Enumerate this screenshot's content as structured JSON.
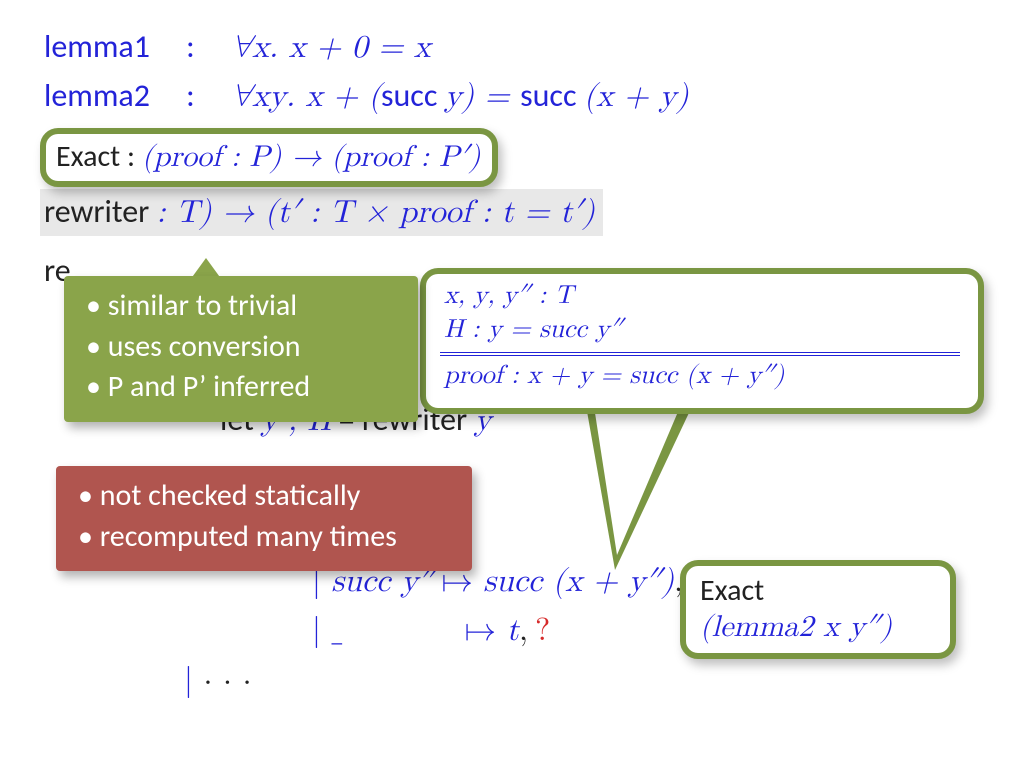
{
  "lemma1_name": "lemma1",
  "lemma2_name": "lemma2",
  "lemma_colon": ":",
  "lemma1_stmt": "∀x. x + 0 = x",
  "lemma2_stmt_pre": "∀xy. x + (",
  "lemma2_succ": "succ ",
  "lemma2_stmt_mid": "y) = ",
  "lemma2_stmt_post": "(x + y)",
  "exact_sig_label": "Exact",
  "exact_sig_colon": " : ",
  "exact_sig_body": "(proof : P) → (proof : P′)",
  "rewriter": "rewriter",
  "rewriter_sig": " : T) → (t′ : T × proof : t = t′)",
  "re_fragment": "re",
  "let_kw": "let ",
  "let_lhs": "y′,  H",
  "let_eq": "  =  ",
  "let_rhs1": "rewriter ",
  "let_rhs2": "y",
  "case_succ_l": "succ y″",
  "case_arrow": " ↦ ",
  "case_succ_r": "succ (x + y″)",
  "case_comma": ",",
  "case_wild": "_",
  "case_wild_r": "t",
  "case_wild_q": "?",
  "dots": "· · ·",
  "bar": "| ",
  "deriv_l1": "x,  y,  y″ : T",
  "deriv_l2": "H : y = succ y″",
  "deriv_l3": "proof : x + y = succ (x + y″)",
  "note_olive": {
    "a": "similar to trivial",
    "b": "uses conversion",
    "c": "P and P’ inferred"
  },
  "note_brick": {
    "a": "not checked statically",
    "b": "recomputed many times"
  },
  "exact2_label": "Exact",
  "exact2_arg": "(lemma2 x y″)"
}
